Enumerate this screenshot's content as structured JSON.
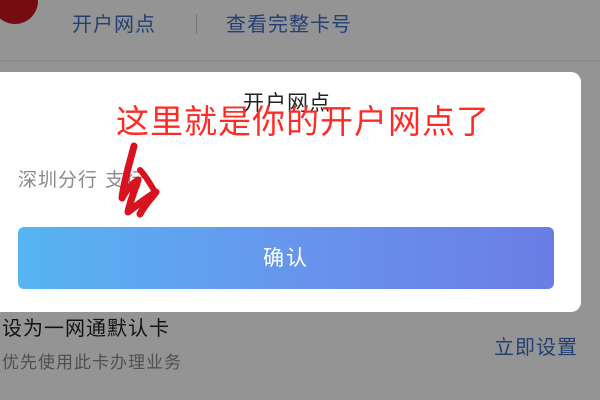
{
  "background": {
    "top_links": {
      "open_branch": "开户网点",
      "view_full_card": "查看完整卡号"
    },
    "default_card": {
      "title": "设为一网通默认卡",
      "subtitle": "优先使用此卡办理业务",
      "action": "立即设置"
    }
  },
  "modal": {
    "title": "开户网点",
    "branch_value": "深圳分行 支行",
    "confirm_label": "确认"
  },
  "annotation": {
    "text": "这里就是你的开户网点了",
    "color": "#ff2a24"
  },
  "colors": {
    "link": "#3d6fc4",
    "button_gradient_start": "#56b5f2",
    "button_gradient_end": "#6a7de6",
    "brand_red": "#c8161e"
  }
}
